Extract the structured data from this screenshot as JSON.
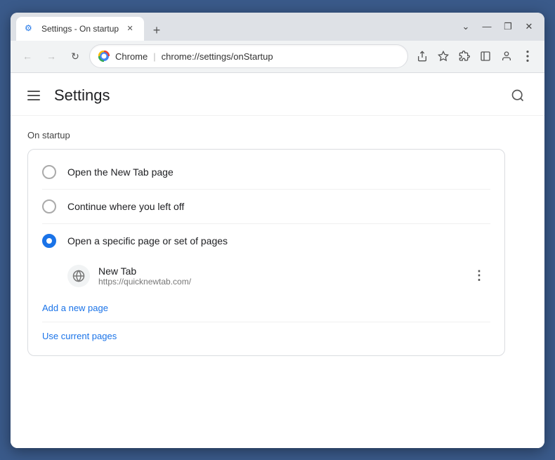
{
  "browser": {
    "tab": {
      "title": "Settings - On startup",
      "favicon": "⚙"
    },
    "new_tab_label": "+",
    "window_controls": {
      "minimize": "—",
      "maximize": "❐",
      "close": "✕",
      "chevron": "⌄"
    },
    "address_bar": {
      "chrome_label": "Chrome",
      "separator": "|",
      "url": "chrome://settings/onStartup",
      "favicon": "🔵"
    },
    "toolbar_buttons": {
      "back": "←",
      "forward": "→",
      "refresh": "↻"
    }
  },
  "page": {
    "title": "Settings",
    "section": "On startup",
    "search_icon": "🔍"
  },
  "options": [
    {
      "id": "new-tab",
      "label": "Open the New Tab page",
      "selected": false
    },
    {
      "id": "continue",
      "label": "Continue where you left off",
      "selected": false
    },
    {
      "id": "specific",
      "label": "Open a specific page or set of pages",
      "selected": true
    }
  ],
  "startup_page": {
    "name": "New Tab",
    "url": "https://quicknewtab.com/"
  },
  "links": {
    "add_new_page": "Add a new page",
    "use_current": "Use current pages"
  }
}
